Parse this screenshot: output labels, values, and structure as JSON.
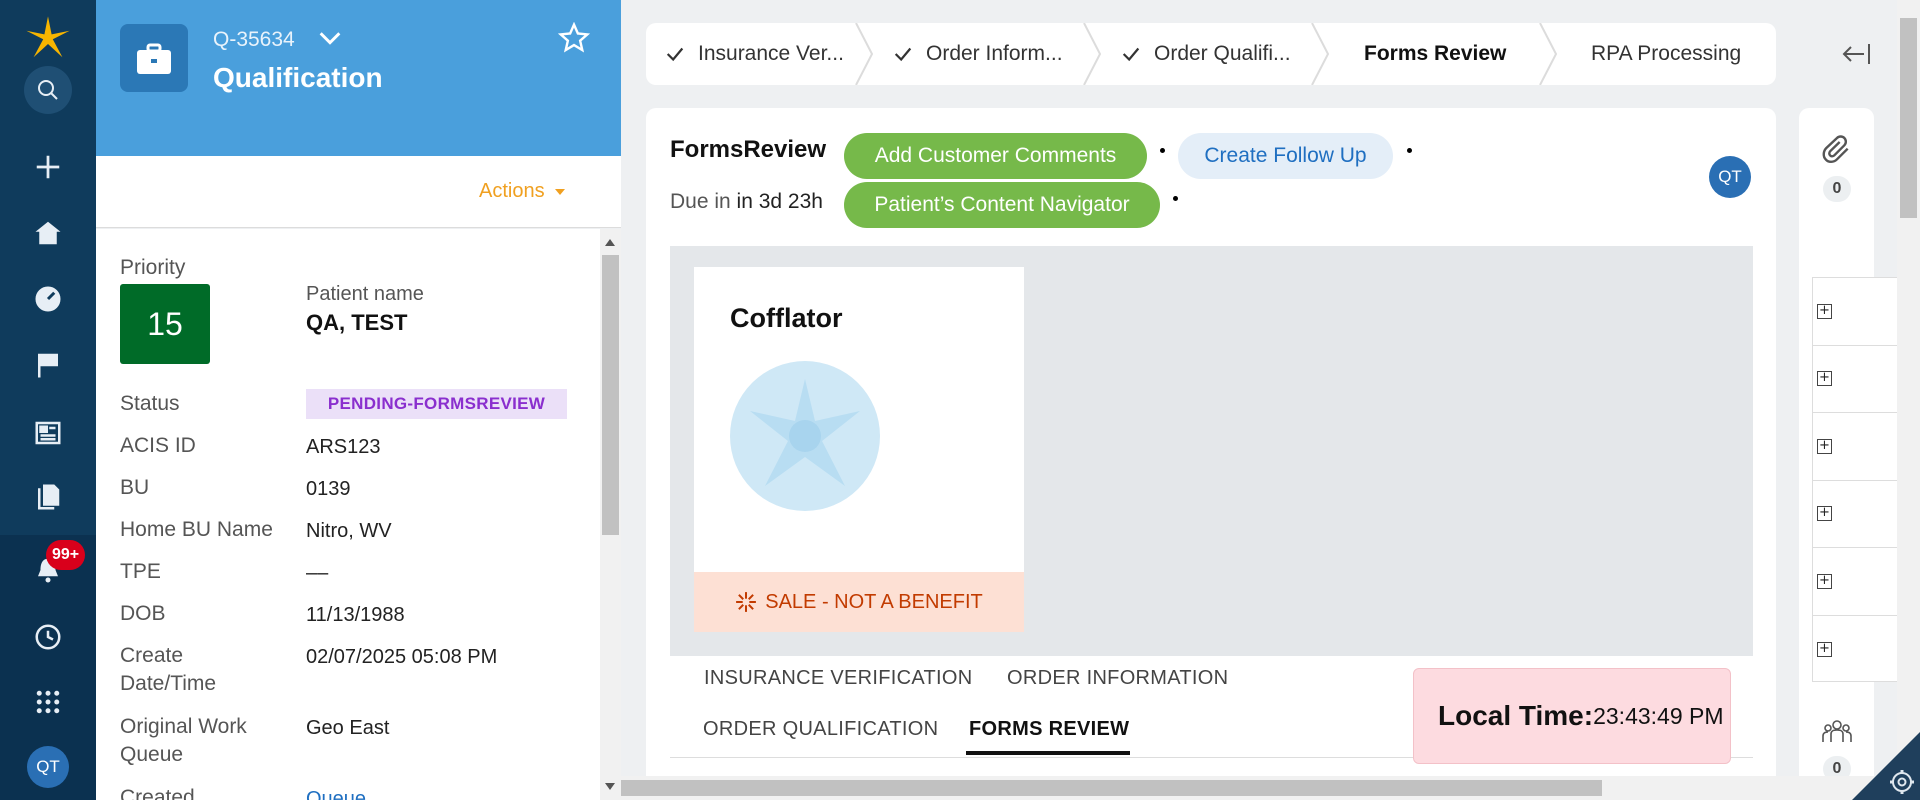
{
  "nav": {
    "notifications_badge": "99+",
    "user_initials": "QT",
    "icons": [
      "logo-icon",
      "search-icon",
      "plus-icon",
      "home-icon",
      "dashboard-icon",
      "flag-icon",
      "news-icon",
      "documents-icon",
      "bell-icon",
      "history-icon",
      "apps-grid-icon"
    ]
  },
  "case": {
    "id": "Q-35634",
    "title": "Qualification",
    "actions_label": "Actions"
  },
  "summary": {
    "priority_label": "Priority",
    "priority_value": "15",
    "patient_name_label": "Patient name",
    "patient_name": "QA, TEST",
    "status_label": "Status",
    "status_value": "PENDING-FORMSREVIEW",
    "acis_label": "ACIS ID",
    "acis_value": "ARS123",
    "bu_label": "BU",
    "bu_value": "0139",
    "home_bu_label": "Home BU Name",
    "home_bu_value": "Nitro, WV",
    "tpe_label": "TPE",
    "tpe_value": "––",
    "dob_label": "DOB",
    "dob_value": "11/13/1988",
    "create_label_1": "Create",
    "create_label_2": "Date/Time",
    "create_value": "02/07/2025 05:08 PM",
    "owq_label_1": "Original Work",
    "owq_label_2": "Queue",
    "owq_value": "Geo East",
    "created_label": "Created",
    "created_value": "Queue"
  },
  "stages": [
    {
      "label": "Insurance Ver...",
      "done": true
    },
    {
      "label": "Order Inform...",
      "done": true
    },
    {
      "label": "Order Qualifi...",
      "done": true
    },
    {
      "label": "Forms Review",
      "active": true
    },
    {
      "label": "RPA Processing"
    }
  ],
  "main": {
    "title": "FormsReview",
    "due_prefix": "Due in",
    "due_value": "in 3d 23h",
    "buttons": {
      "add_comments": "Add Customer Comments",
      "create_follow_up": "Create Follow Up",
      "content_navigator": "Patient’s Content Navigator"
    },
    "user_initials": "QT",
    "product": {
      "name": "Cofflator",
      "sale_text": "SALE - NOT A BENEFIT"
    },
    "tabs": [
      "INSURANCE VERIFICATION",
      "ORDER INFORMATION",
      "ORDER QUALIFICATION",
      "FORMS REVIEW"
    ],
    "active_tab": "FORMS REVIEW",
    "local_time_label": "Local Time:",
    "local_time_value": "23:43:49 PM"
  },
  "utility": {
    "attachments_count": "0",
    "followers_count": "0"
  },
  "colors": {
    "nav_bg": "#0f3b5c",
    "header_blue": "#4a9fdc",
    "priority_green": "#006b28",
    "button_green": "#76b94a",
    "accent_orange": "#f0a020",
    "status_purple": "#8a2fce"
  }
}
